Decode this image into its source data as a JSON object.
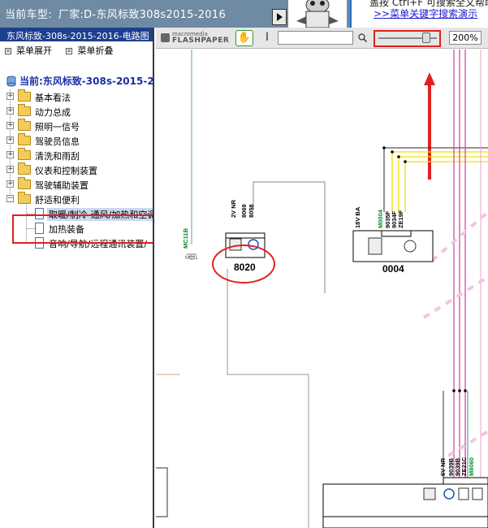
{
  "topbar": {
    "car_model_label": "当前车型:",
    "car_model_value": "厂家:D-东风标致308s2015-2016",
    "help_line1": "盖按 Ctrl+F 可搜索全文帮助",
    "help_link": ">>菜单关键字搜索演示"
  },
  "sidebar": {
    "panel_title": "东风标致-308s-2015-2016-电路图",
    "expand_label": "菜单展开",
    "collapse_label": "菜单折叠",
    "current_label": "当前:东风标致-308s-2015-2016",
    "items": [
      {
        "label": "基本看法",
        "expanded": false
      },
      {
        "label": "动力总成",
        "expanded": false
      },
      {
        "label": "照明一信号",
        "expanded": false
      },
      {
        "label": "驾驶员信息",
        "expanded": false
      },
      {
        "label": "清洗和雨刮",
        "expanded": false
      },
      {
        "label": "仪表和控制装置",
        "expanded": false
      },
      {
        "label": "驾驶辅助装置",
        "expanded": false
      },
      {
        "label": "舒适和便利",
        "expanded": true
      }
    ],
    "children": [
      {
        "label": "取暖/制冷-通风/加热和空调",
        "selected": true
      },
      {
        "label": "加热装备",
        "selected": false
      },
      {
        "label": "音响/导航/远程通讯装置/",
        "selected": false
      }
    ]
  },
  "viewer": {
    "logo_top": "macromedia",
    "logo_bottom": "FLASHPAPER",
    "search_value": "",
    "zoom_label": "200%",
    "zoom_fraction": 0.82
  },
  "diagram": {
    "components": [
      {
        "code": "8020",
        "pins": [
          "2V NR",
          "8069",
          "8058"
        ]
      },
      {
        "code": "0004",
        "pins": [
          "18V BA",
          "M0004",
          "9035F",
          "9034F",
          "ZE19F"
        ],
        "pin_numbers": [
          "9",
          "2",
          "1",
          "7"
        ]
      },
      {
        "pins": [
          "6V NR",
          "9039B",
          "9039B",
          "ZE21C",
          "M8060"
        ],
        "pin_numbers": [
          "4",
          "5",
          "3",
          "1"
        ]
      }
    ],
    "wire_labels": [
      "MC11B",
      "MC11"
    ],
    "pin_row": [
      "NR",
      "12",
      "22",
      "23",
      "32",
      "33",
      "13",
      "26",
      "33",
      "25",
      "9",
      "5"
    ]
  },
  "colors": {
    "topbar": "#6f8aa3",
    "panel_title": "#1c3f8e",
    "highlight": "#e02020",
    "wire_yellow": "#f0e000",
    "wire_pink": "#d24ca8",
    "wire_green": "#4db88a"
  }
}
